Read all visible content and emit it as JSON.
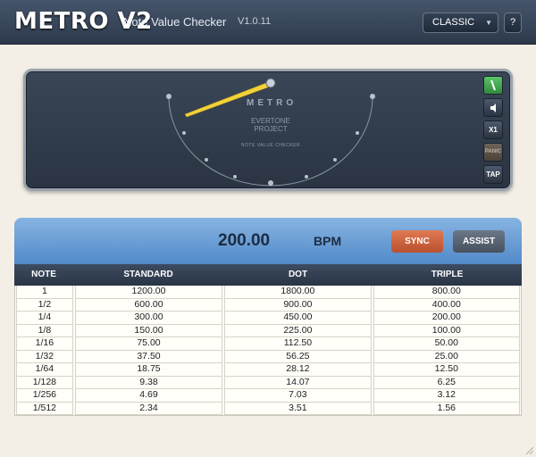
{
  "header": {
    "title": "METRO V2",
    "subtitle": "Note Value Checker",
    "version": "V1.0.11",
    "theme_select": "CLASSIC",
    "help_label": "?"
  },
  "metronome": {
    "brand": "METRO",
    "maker_line1": "EVERTONE",
    "maker_line2": "PROJECT",
    "caption": "NOTE VALUE CHECKER",
    "side_buttons": {
      "pendulum": "",
      "sound": "",
      "multiplier": "X1",
      "panic": "PANIC",
      "tap": "TAP"
    }
  },
  "tempo": {
    "bpm_value": "200.00",
    "bpm_unit": "BPM",
    "sync_label": "SYNC",
    "assist_label": "ASSIST"
  },
  "table": {
    "columns": [
      "NOTE",
      "STANDARD",
      "DOT",
      "TRIPLE"
    ],
    "rows": [
      [
        "1",
        "1200.00",
        "1800.00",
        "800.00"
      ],
      [
        "1/2",
        "600.00",
        "900.00",
        "400.00"
      ],
      [
        "1/4",
        "300.00",
        "450.00",
        "200.00"
      ],
      [
        "1/8",
        "150.00",
        "225.00",
        "100.00"
      ],
      [
        "1/16",
        "75.00",
        "112.50",
        "50.00"
      ],
      [
        "1/32",
        "37.50",
        "56.25",
        "25.00"
      ],
      [
        "1/64",
        "18.75",
        "28.12",
        "12.50"
      ],
      [
        "1/128",
        "9.38",
        "14.07",
        "6.25"
      ],
      [
        "1/256",
        "4.69",
        "7.03",
        "3.12"
      ],
      [
        "1/512",
        "2.34",
        "3.51",
        "1.56"
      ]
    ]
  },
  "colors": {
    "accent_blue": "#5189c8",
    "sync_orange": "#d06840",
    "needle_yellow": "#f2d23a",
    "active_green": "#3fa94f"
  }
}
